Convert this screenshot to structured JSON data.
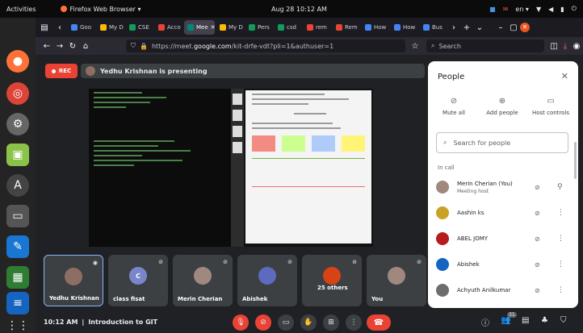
{
  "topbar": {
    "activities": "Activities",
    "app_name": "Firefox Web Browser ▾",
    "clock": "Aug 28  10:12 AM",
    "lang": "en ▾"
  },
  "dock": {
    "items": [
      "firefox-icon",
      "chrome-icon",
      "settings-icon",
      "files-icon",
      "software-icon",
      "folder-icon",
      "text-editor-icon",
      "spreadsheet-icon",
      "document-icon",
      "app-grid-icon"
    ]
  },
  "browser": {
    "tabs": [
      {
        "label": "Goo",
        "color": "#4285f4"
      },
      {
        "label": "My D",
        "color": "#fbbc04"
      },
      {
        "label": "CSE",
        "color": "#0f9d58"
      },
      {
        "label": "Acco",
        "color": "#ea4335"
      },
      {
        "label": "Mee",
        "color": "#00897b",
        "active": true
      },
      {
        "label": "My D",
        "color": "#fbbc04"
      },
      {
        "label": "Pers",
        "color": "#0f9d58"
      },
      {
        "label": "csd",
        "color": "#0f9d58"
      },
      {
        "label": "rem",
        "color": "#ea4335"
      },
      {
        "label": "Rem",
        "color": "#ea4335"
      },
      {
        "label": "How",
        "color": "#4285f4"
      },
      {
        "label": "How",
        "color": "#4285f4"
      },
      {
        "label": "Bus",
        "color": "#4285f4"
      }
    ],
    "url_prefix": "https://meet.",
    "url_host": "google.com",
    "url_rest": "/kit-drfe-vdt?pli=1&authuser=1",
    "search_placeholder": "Search"
  },
  "meet": {
    "rec_label": "REC",
    "presenter": "Yedhu Krishnan is presenting",
    "meeting_time": "10:12 AM",
    "meeting_title": "Introduction to GIT",
    "participant_count": "31",
    "tiles": [
      {
        "name": "Yedhu Krishnan",
        "avatar_color": "#8d6e63",
        "active": true
      },
      {
        "name": "class fisat",
        "avatar_color": "#7986cb",
        "initial": "C"
      },
      {
        "name": "Merin Cherian",
        "avatar_color": "#a1887f"
      },
      {
        "name": "Abishek",
        "avatar_color": "#5c6bc0"
      },
      {
        "name": "25 others",
        "avatar_color": "#d84315"
      },
      {
        "name": "You",
        "avatar_color": "#a1887f"
      }
    ]
  },
  "people": {
    "title": "People",
    "actions": [
      "Mute all",
      "Add people",
      "Host controls"
    ],
    "search_placeholder": "Search for people",
    "section": "In call",
    "list": [
      {
        "name": "Merin Cherian (You)",
        "sub": "Meeting host",
        "color": "#a1887f"
      },
      {
        "name": "Aashin ks",
        "sub": "",
        "color": "#c9a227"
      },
      {
        "name": "ABEL JOMY",
        "sub": "",
        "color": "#b71c1c"
      },
      {
        "name": "Abishek",
        "sub": "",
        "color": "#1565c0"
      },
      {
        "name": "Achyuth Anilkumar",
        "sub": "",
        "color": "#6d6d6d"
      }
    ]
  }
}
